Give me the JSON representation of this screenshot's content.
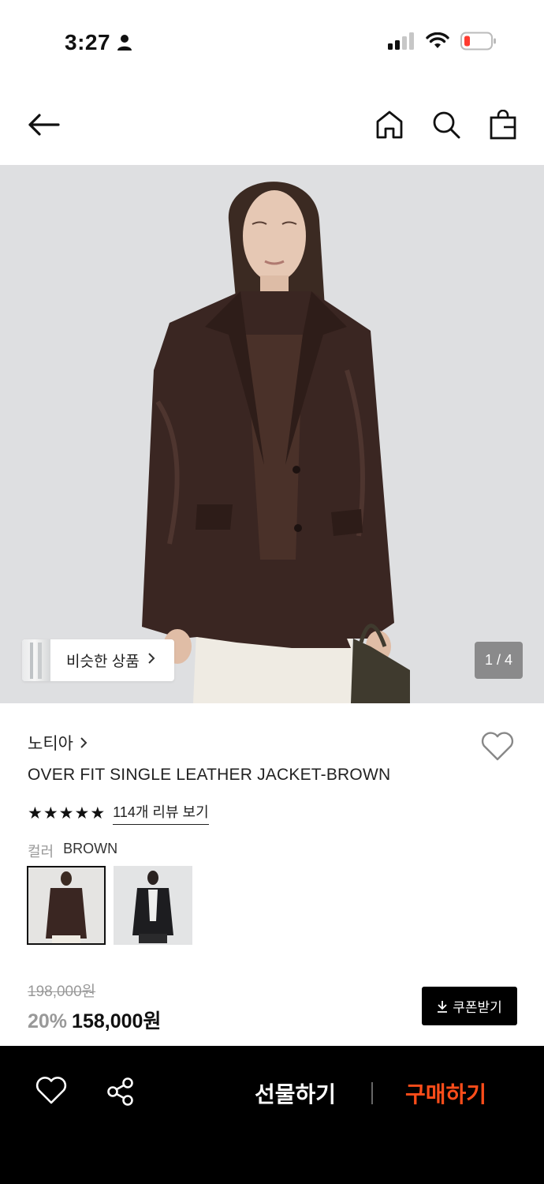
{
  "status_bar": {
    "time": "3:27",
    "icons": [
      "person-icon",
      "cellular-signal-icon",
      "wifi-icon",
      "battery-low-icon"
    ]
  },
  "header": {
    "icons": [
      "back-arrow-icon",
      "home-icon",
      "search-icon",
      "shopping-bag-icon"
    ]
  },
  "hero": {
    "similar_label": "비슷한 상품",
    "page_indicator": "1 / 4",
    "background_color": "#dfe1e3",
    "jacket_color": "#3a2622"
  },
  "product": {
    "brand": "노티아",
    "name": "OVER FIT SINGLE LEATHER JACKET-BROWN",
    "rating": 5,
    "review_link": "114개 리뷰 보기",
    "color_label": "컬러",
    "color_value": "BROWN",
    "swatches": [
      "brown",
      "black"
    ]
  },
  "price": {
    "original": "198,000원",
    "discount": "20%",
    "sale": "158,000원",
    "coupon_label": "쿠폰받기"
  },
  "bottom_bar": {
    "gift_label": "선물하기",
    "buy_label": "구매하기",
    "buy_color": "#ff4d1a"
  }
}
